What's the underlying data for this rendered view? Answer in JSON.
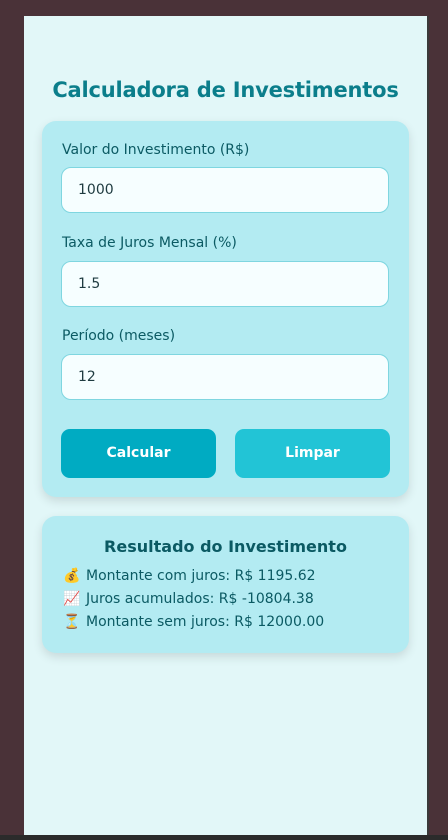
{
  "header": {
    "title": "Calculadora de Investimentos"
  },
  "form": {
    "investment_label": "Valor do Investimento (R$)",
    "investment_value": "1000",
    "rate_label": "Taxa de Juros Mensal (%)",
    "rate_value": "1.5",
    "period_label": "Período (meses)",
    "period_value": "12",
    "calc_button": "Calcular",
    "clear_button": "Limpar"
  },
  "result": {
    "title": "Resultado do Investimento",
    "lines": [
      {
        "icon": "money-bag-icon",
        "emoji": "💰",
        "text": "Montante com juros: R$ 1195.62"
      },
      {
        "icon": "chart-increasing-icon",
        "emoji": "📈",
        "text": "Juros acumulados: R$ -10804.38"
      },
      {
        "icon": "hourglass-icon",
        "emoji": "⏳",
        "text": "Montante sem juros: R$ 12000.00"
      }
    ]
  },
  "colors": {
    "page_bg": "#e2f7f8",
    "card_bg": "#b3ebf2",
    "title": "#0b7e8b",
    "text": "#0b5a63",
    "calc_button": "#00abc2",
    "clear_button": "#22c4d6"
  }
}
